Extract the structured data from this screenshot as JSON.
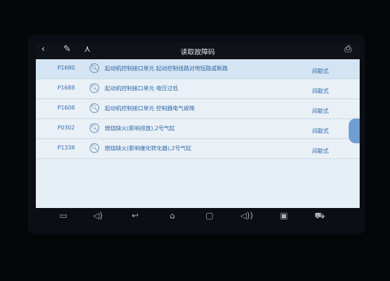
{
  "titlebar": {
    "title": "读取故障码",
    "back_icon": "‹",
    "edit_icon": "✎",
    "share_icon": "⋏",
    "print_icon": "⎙"
  },
  "dtc_list": [
    {
      "code": "P1680",
      "description": "起动机控制接口单元 起动控制线路对地短路或断路",
      "type": "间歇式"
    },
    {
      "code": "P1688",
      "description": "起动机控制接口单元 电压过低",
      "type": "间歇式"
    },
    {
      "code": "P1608",
      "description": "起动机控制接口单元 控制器电气故障",
      "type": "间歇式"
    },
    {
      "code": "P0302",
      "description": "燃烧缺火(影响排放),2号气缸",
      "type": "间歇式"
    },
    {
      "code": "P1338",
      "description": "燃烧缺火(影响催化转化器),2号气缸",
      "type": "间歇式"
    }
  ],
  "navbar": {
    "screenshot_icon": "▭",
    "volume_down_icon": "◁)",
    "back_icon": "↩",
    "home_icon": "⌂",
    "recent_icon": "▢",
    "volume_up_icon": "◁))",
    "app_icon": "▣",
    "car_icon": "⛟"
  },
  "colors": {
    "screen_bg": "#e7eff6",
    "text_blue": "#2f67a3",
    "titlebar_bg": "#0f1217"
  }
}
